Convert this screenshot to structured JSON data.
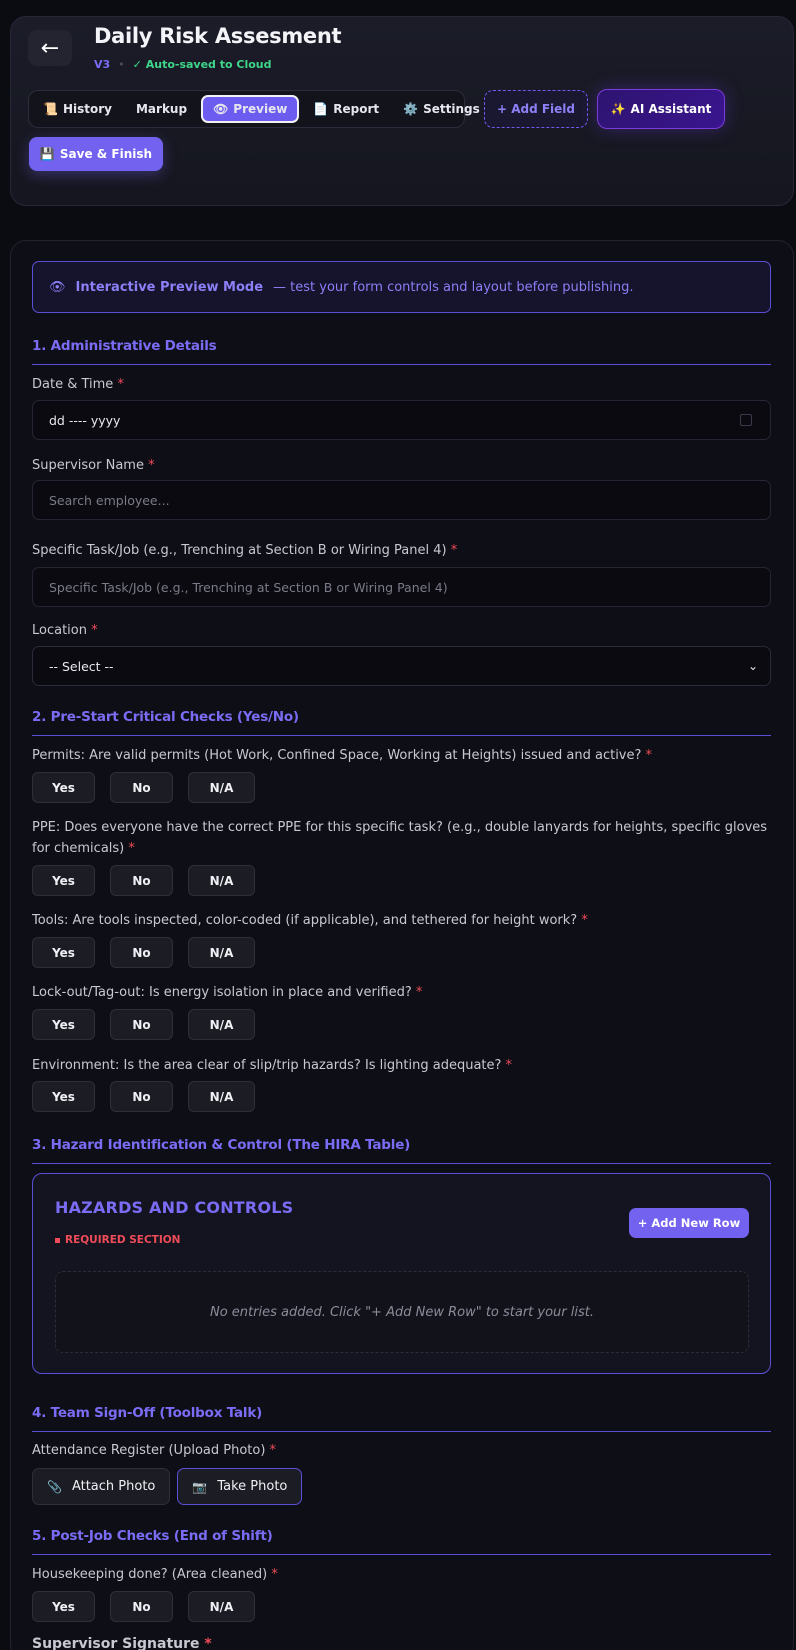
{
  "header": {
    "back_icon": "←",
    "title": "Daily Risk Assesment",
    "version": "V3",
    "separator": "•",
    "autosave": "✓ Auto-saved to Cloud"
  },
  "tabs": [
    {
      "icon": "📜",
      "label": "History"
    },
    {
      "icon": "",
      "label": "Markup"
    },
    {
      "icon": "👁",
      "label": "Preview"
    },
    {
      "icon": "📄",
      "label": "Report"
    },
    {
      "icon": "⚙️",
      "label": "Settings"
    }
  ],
  "active_tab": "Preview",
  "toolbar": {
    "add_field": "+ Add Field",
    "ai_icon": "✨",
    "ai_label": "AI Assistant",
    "save_icon": "💾",
    "save_label": "Save & Finish"
  },
  "banner": {
    "icon": "👁",
    "title": "Interactive Preview Mode",
    "text": "— test your form controls and layout before publishing."
  },
  "sections": {
    "s1": "1. Administrative Details",
    "s2": "2. Pre-Start Critical Checks (Yes/No)",
    "s3": "3. Hazard Identification & Control (The HIRA Table)",
    "s4": "4. Team Sign-Off (Toolbox Talk)",
    "s5": "5. Post-Job Checks (End of Shift)"
  },
  "fields": {
    "date_label": "Date & Time",
    "date_value": "dd ---- yyyy",
    "supervisor_label": "Supervisor Name",
    "supervisor_placeholder": "Search employee...",
    "task_label": "Specific Task/Job (e.g., Trenching at Section B or Wiring Panel 4)",
    "task_placeholder": "Specific Task/Job (e.g., Trenching at Section B or Wiring Panel 4)",
    "location_label": "Location",
    "location_value": "-- Select --",
    "required_mark": "*"
  },
  "checks": [
    {
      "question": "Permits: Are valid permits (Hot Work, Confined Space, Working at Heights) issued and active?"
    },
    {
      "question": "PPE: Does everyone have the correct PPE for this specific task? (e.g., double lanyards for heights, specific gloves for chemicals)"
    },
    {
      "question": "Tools: Are tools inspected, color-coded (if applicable), and tethered for height work?"
    },
    {
      "question": "Lock-out/Tag-out: Is energy isolation in place and verified?"
    },
    {
      "question": "Environment: Is the area clear of slip/trip hazards? Is lighting adequate?"
    }
  ],
  "choice_labels": {
    "yes": "Yes",
    "no": "No",
    "na": "N/A"
  },
  "hira": {
    "title": "HAZARDS AND CONTROLS",
    "required": "REQUIRED SECTION",
    "add_row": "+ Add New Row",
    "empty": "No entries added. Click \"+ Add New Row\" to start your list."
  },
  "signoff": {
    "attendance_label": "Attendance Register (Upload Photo)",
    "attach_icon": "📎",
    "attach_label": "Attach Photo",
    "camera_icon": "📷",
    "take_label": "Take Photo"
  },
  "postjob": {
    "housekeeping_label": "Housekeeping done? (Area cleaned)",
    "signature_label": "Supervisor Signature"
  },
  "colors": {
    "accent": "#7262ef",
    "accent_text": "#7b6cf6",
    "required": "#ef4b58",
    "success": "#3ed68a",
    "background": "#0b0b12"
  }
}
